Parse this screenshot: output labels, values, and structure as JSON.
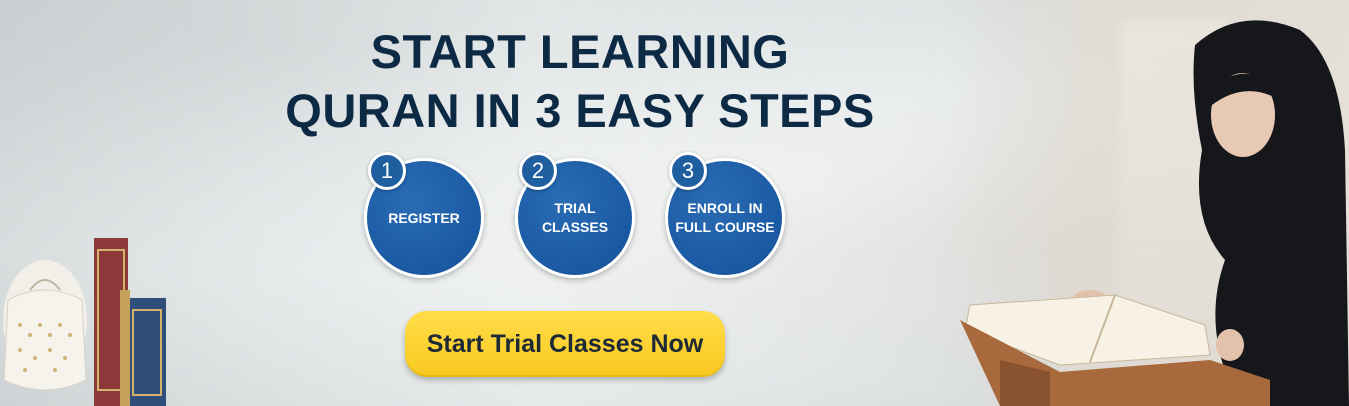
{
  "banner": {
    "headline_line1": "START LEARNING",
    "headline_line2": "QURAN IN 3 EASY STEPS"
  },
  "steps": [
    {
      "number": "1",
      "line1": "REGISTER",
      "line2": ""
    },
    {
      "number": "2",
      "line1": "TRIAL",
      "line2": "CLASSES"
    },
    {
      "number": "3",
      "line1": "ENROLL IN",
      "line2": "FULL COURSE"
    }
  ],
  "cta": {
    "label": "Start Trial Classes Now"
  },
  "colors": {
    "headline": "#0d2a44",
    "step_circle": "#1a5aa3",
    "cta_yellow": "#f9c81e",
    "background": "#e4e8e9"
  },
  "icons": {
    "left": "lantern-and-books-illustration",
    "right": "woman-reading-quran-photo"
  }
}
